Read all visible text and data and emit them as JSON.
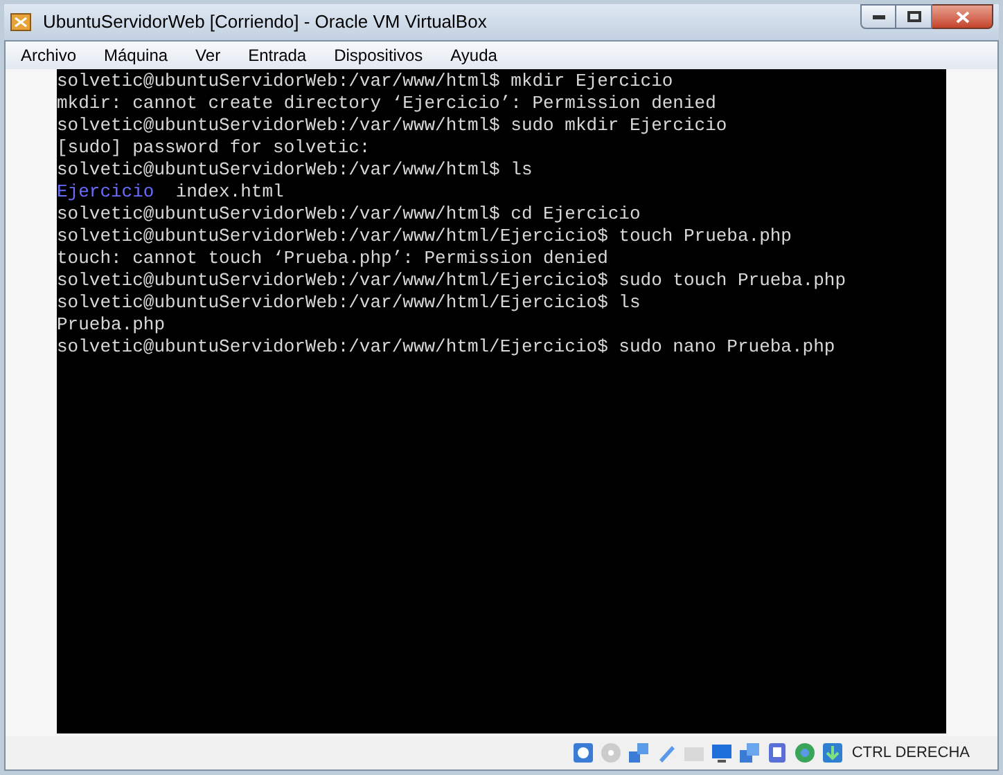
{
  "window": {
    "title": "UbuntuServidorWeb [Corriendo] - Oracle VM VirtualBox"
  },
  "menu": [
    "Archivo",
    "Máquina",
    "Ver",
    "Entrada",
    "Dispositivos",
    "Ayuda"
  ],
  "terminal": {
    "lines": [
      [
        {
          "text": "solvetic@ubuntuServidorWeb:/var/www/html$ mkdir Ejercicio",
          "kind": "plain"
        }
      ],
      [
        {
          "text": "mkdir: cannot create directory ‘Ejercicio’: Permission denied",
          "kind": "plain"
        }
      ],
      [
        {
          "text": "solvetic@ubuntuServidorWeb:/var/www/html$ sudo mkdir Ejercicio",
          "kind": "plain"
        }
      ],
      [
        {
          "text": "[sudo] password for solvetic:",
          "kind": "plain"
        }
      ],
      [
        {
          "text": "solvetic@ubuntuServidorWeb:/var/www/html$ ls",
          "kind": "plain"
        }
      ],
      [
        {
          "text": "Ejercicio",
          "kind": "directory"
        },
        {
          "text": "  index.html",
          "kind": "plain"
        }
      ],
      [
        {
          "text": "solvetic@ubuntuServidorWeb:/var/www/html$ cd Ejercicio",
          "kind": "plain"
        }
      ],
      [
        {
          "text": "solvetic@ubuntuServidorWeb:/var/www/html/Ejercicio$ touch Prueba.php",
          "kind": "plain"
        }
      ],
      [
        {
          "text": "touch: cannot touch ‘Prueba.php’: Permission denied",
          "kind": "plain"
        }
      ],
      [
        {
          "text": "solvetic@ubuntuServidorWeb:/var/www/html/Ejercicio$ sudo touch Prueba.php",
          "kind": "plain"
        }
      ],
      [
        {
          "text": "solvetic@ubuntuServidorWeb:/var/www/html/Ejercicio$ ls",
          "kind": "plain"
        }
      ],
      [
        {
          "text": "Prueba.php",
          "kind": "plain"
        }
      ],
      [
        {
          "text": "solvetic@ubuntuServidorWeb:/var/www/html/Ejercicio$ sudo nano Prueba.php",
          "kind": "plain"
        }
      ]
    ]
  },
  "status_bar": {
    "host_key": "CTRL DERECHA"
  }
}
